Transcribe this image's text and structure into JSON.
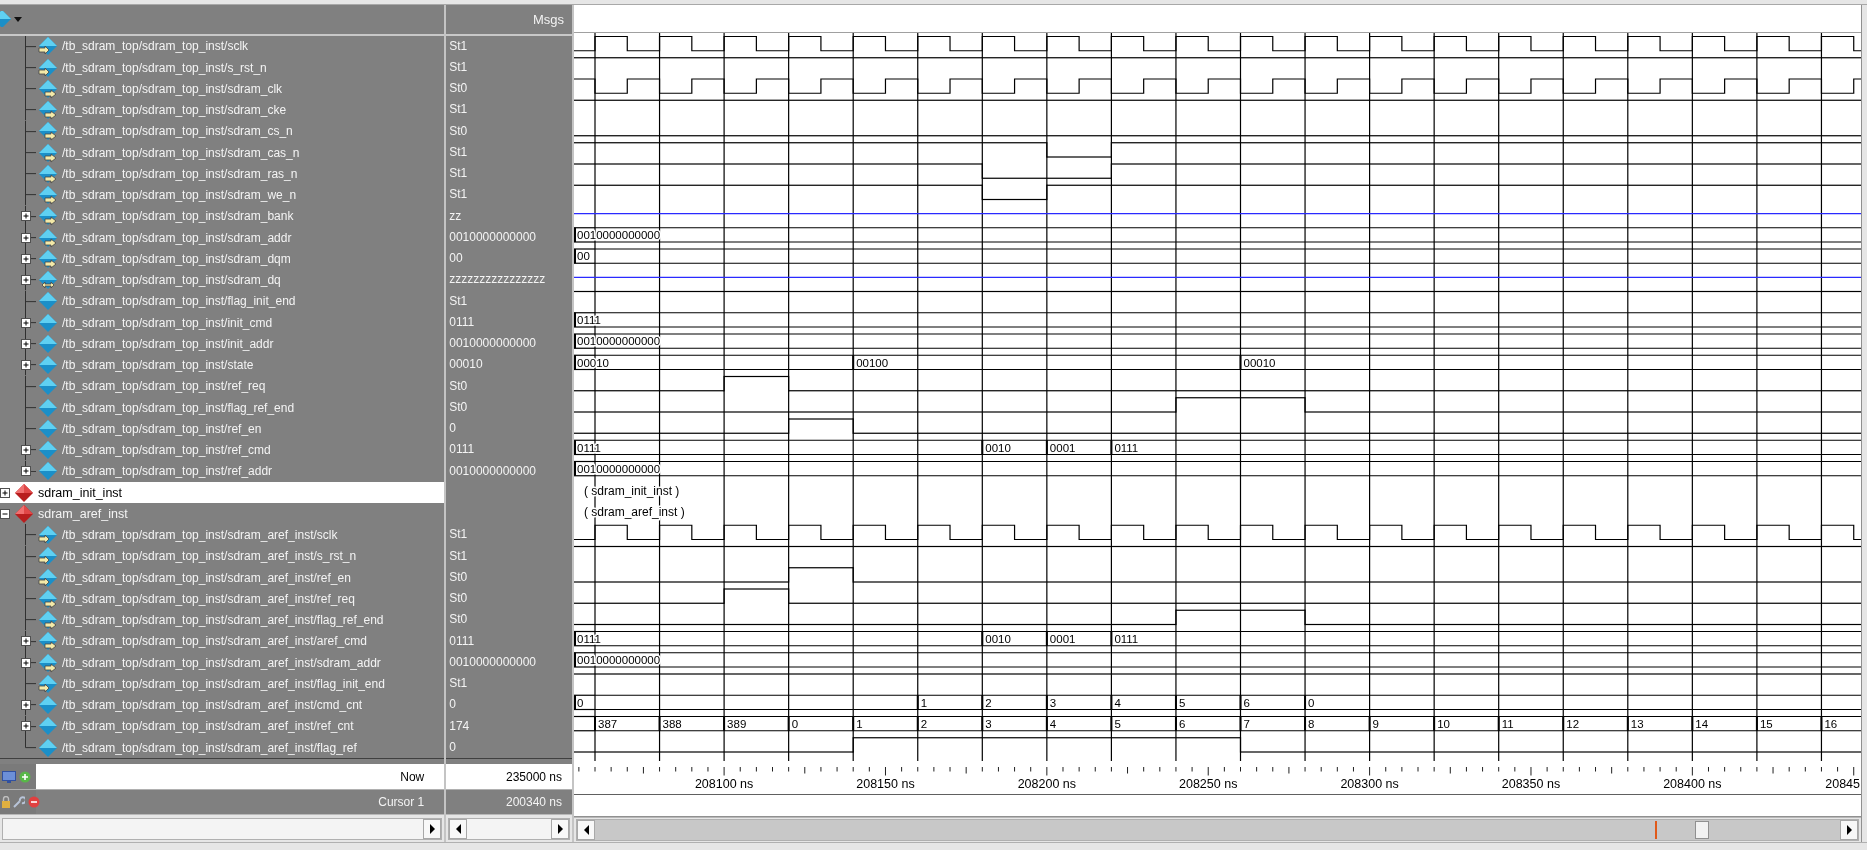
{
  "values_header": "Msgs",
  "time_labels": [
    "208100 ns",
    "208150 ns",
    "208200 ns",
    "208250 ns",
    "208300 ns",
    "208350 ns",
    "208400 ns",
    "20845"
  ],
  "signals": [
    {
      "name": "/tb_sdram_top/sdram_top_inst/sclk",
      "value": "St1",
      "kind": "input",
      "wave": {
        "kind": "clock",
        "inverted": false
      }
    },
    {
      "name": "/tb_sdram_top/sdram_top_inst/s_rst_n",
      "value": "St1",
      "kind": "input",
      "wave": {
        "kind": "bit",
        "high": [
          true,
          true,
          true,
          true,
          true,
          true,
          true,
          true,
          true,
          true,
          true,
          true,
          true,
          true,
          true,
          true,
          true,
          true,
          true,
          true,
          true
        ]
      }
    },
    {
      "name": "/tb_sdram_top/sdram_top_inst/sdram_clk",
      "value": "St0",
      "kind": "output",
      "wave": {
        "kind": "clock",
        "inverted": true
      }
    },
    {
      "name": "/tb_sdram_top/sdram_top_inst/sdram_cke",
      "value": "St1",
      "kind": "output",
      "wave": {
        "kind": "bit",
        "high": [
          true,
          true,
          true,
          true,
          true,
          true,
          true,
          true,
          true,
          true,
          true,
          true,
          true,
          true,
          true,
          true,
          true,
          true,
          true,
          true,
          true
        ]
      }
    },
    {
      "name": "/tb_sdram_top/sdram_top_inst/sdram_cs_n",
      "value": "St0",
      "kind": "output",
      "wave": {
        "kind": "bit",
        "high": [
          false,
          false,
          false,
          false,
          false,
          false,
          false,
          false,
          false,
          false,
          false,
          false,
          false,
          false,
          false,
          false,
          false,
          false,
          false,
          false,
          false
        ]
      }
    },
    {
      "name": "/tb_sdram_top/sdram_top_inst/sdram_cas_n",
      "value": "St1",
      "kind": "output",
      "wave": {
        "kind": "bit",
        "high": [
          true,
          true,
          true,
          true,
          true,
          true,
          true,
          true,
          false,
          true,
          true,
          true,
          true,
          true,
          true,
          true,
          true,
          true,
          true,
          true,
          true
        ]
      }
    },
    {
      "name": "/tb_sdram_top/sdram_top_inst/sdram_ras_n",
      "value": "St1",
      "kind": "output",
      "wave": {
        "kind": "bit",
        "high": [
          true,
          true,
          true,
          true,
          true,
          true,
          true,
          false,
          false,
          true,
          true,
          true,
          true,
          true,
          true,
          true,
          true,
          true,
          true,
          true,
          true
        ]
      }
    },
    {
      "name": "/tb_sdram_top/sdram_top_inst/sdram_we_n",
      "value": "St1",
      "kind": "output",
      "wave": {
        "kind": "bit",
        "high": [
          true,
          true,
          true,
          true,
          true,
          true,
          true,
          false,
          true,
          true,
          true,
          true,
          true,
          true,
          true,
          true,
          true,
          true,
          true,
          true,
          true
        ]
      }
    },
    {
      "name": "/tb_sdram_top/sdram_top_inst/sdram_bank",
      "value": "zz",
      "kind": "output",
      "expanded": false,
      "wave": {
        "kind": "float"
      }
    },
    {
      "name": "/tb_sdram_top/sdram_top_inst/sdram_addr",
      "value": "0010000000000",
      "kind": "output",
      "expanded": false,
      "wave": {
        "kind": "bus",
        "cycles": [
          {
            "new": true,
            "value": "0010000000000"
          },
          {
            "new": false
          },
          {
            "new": false
          },
          {
            "new": false
          },
          {
            "new": false
          },
          {
            "new": false
          },
          {
            "new": false
          },
          {
            "new": false
          },
          {
            "new": false
          },
          {
            "new": false
          },
          {
            "new": false
          },
          {
            "new": false
          },
          {
            "new": false
          },
          {
            "new": false
          },
          {
            "new": false
          },
          {
            "new": false
          },
          {
            "new": false
          },
          {
            "new": false
          },
          {
            "new": false
          },
          {
            "new": false
          },
          {
            "new": false
          }
        ]
      }
    },
    {
      "name": "/tb_sdram_top/sdram_top_inst/sdram_dqm",
      "value": "00",
      "kind": "output",
      "expanded": false,
      "wave": {
        "kind": "bus",
        "cycles": [
          {
            "new": true,
            "value": "00"
          },
          {
            "new": false
          },
          {
            "new": false
          },
          {
            "new": false
          },
          {
            "new": false
          },
          {
            "new": false
          },
          {
            "new": false
          },
          {
            "new": false
          },
          {
            "new": false
          },
          {
            "new": false
          },
          {
            "new": false
          },
          {
            "new": false
          },
          {
            "new": false
          },
          {
            "new": false
          },
          {
            "new": false
          },
          {
            "new": false
          },
          {
            "new": false
          },
          {
            "new": false
          },
          {
            "new": false
          },
          {
            "new": false
          },
          {
            "new": false
          }
        ]
      }
    },
    {
      "name": "/tb_sdram_top/sdram_top_inst/sdram_dq",
      "value": "zzzzzzzzzzzzzzzz",
      "kind": "inout",
      "expanded": false,
      "wave": {
        "kind": "float"
      }
    },
    {
      "name": "/tb_sdram_top/sdram_top_inst/flag_init_end",
      "value": "St1",
      "kind": "internal",
      "wave": {
        "kind": "bit",
        "high": [
          true,
          true,
          true,
          true,
          true,
          true,
          true,
          true,
          true,
          true,
          true,
          true,
          true,
          true,
          true,
          true,
          true,
          true,
          true,
          true,
          true
        ]
      }
    },
    {
      "name": "/tb_sdram_top/sdram_top_inst/init_cmd",
      "value": "0111",
      "kind": "internal",
      "expanded": false,
      "wave": {
        "kind": "bus",
        "cycles": [
          {
            "new": true,
            "value": "0111"
          },
          {
            "new": false
          },
          {
            "new": false
          },
          {
            "new": false
          },
          {
            "new": false
          },
          {
            "new": false
          },
          {
            "new": false
          },
          {
            "new": false
          },
          {
            "new": false
          },
          {
            "new": false
          },
          {
            "new": false
          },
          {
            "new": false
          },
          {
            "new": false
          },
          {
            "new": false
          },
          {
            "new": false
          },
          {
            "new": false
          },
          {
            "new": false
          },
          {
            "new": false
          },
          {
            "new": false
          },
          {
            "new": false
          },
          {
            "new": false
          }
        ]
      }
    },
    {
      "name": "/tb_sdram_top/sdram_top_inst/init_addr",
      "value": "0010000000000",
      "kind": "internal",
      "expanded": false,
      "wave": {
        "kind": "bus",
        "cycles": [
          {
            "new": true,
            "value": "0010000000000"
          },
          {
            "new": false
          },
          {
            "new": false
          },
          {
            "new": false
          },
          {
            "new": false
          },
          {
            "new": false
          },
          {
            "new": false
          },
          {
            "new": false
          },
          {
            "new": false
          },
          {
            "new": false
          },
          {
            "new": false
          },
          {
            "new": false
          },
          {
            "new": false
          },
          {
            "new": false
          },
          {
            "new": false
          },
          {
            "new": false
          },
          {
            "new": false
          },
          {
            "new": false
          },
          {
            "new": false
          },
          {
            "new": false
          },
          {
            "new": false
          }
        ]
      }
    },
    {
      "name": "/tb_sdram_top/sdram_top_inst/state",
      "value": "00010",
      "kind": "internal",
      "expanded": false,
      "wave": {
        "kind": "bus",
        "cycles": [
          {
            "new": true,
            "value": "00010"
          },
          {
            "new": false
          },
          {
            "new": false
          },
          {
            "new": false
          },
          {
            "new": false
          },
          {
            "new": true,
            "value": "00100"
          },
          {
            "new": false
          },
          {
            "new": false
          },
          {
            "new": false
          },
          {
            "new": false
          },
          {
            "new": false
          },
          {
            "new": true,
            "value": "00010"
          },
          {
            "new": false
          },
          {
            "new": false
          },
          {
            "new": false
          },
          {
            "new": false
          },
          {
            "new": false
          },
          {
            "new": false
          },
          {
            "new": false
          },
          {
            "new": false
          },
          {
            "new": false
          }
        ]
      }
    },
    {
      "name": "/tb_sdram_top/sdram_top_inst/ref_req",
      "value": "St0",
      "kind": "internal",
      "wave": {
        "kind": "bit",
        "high": [
          false,
          false,
          false,
          true,
          false,
          false,
          false,
          false,
          false,
          false,
          false,
          false,
          false,
          false,
          false,
          false,
          false,
          false,
          false,
          false,
          false
        ]
      }
    },
    {
      "name": "/tb_sdram_top/sdram_top_inst/flag_ref_end",
      "value": "St0",
      "kind": "internal",
      "wave": {
        "kind": "bit",
        "high": [
          false,
          false,
          false,
          false,
          false,
          false,
          false,
          false,
          false,
          false,
          true,
          true,
          false,
          false,
          false,
          false,
          false,
          false,
          false,
          false,
          false
        ]
      }
    },
    {
      "name": "/tb_sdram_top/sdram_top_inst/ref_en",
      "value": "0",
      "kind": "internal",
      "wave": {
        "kind": "bit",
        "high": [
          false,
          false,
          false,
          false,
          true,
          false,
          false,
          false,
          false,
          false,
          false,
          false,
          false,
          false,
          false,
          false,
          false,
          false,
          false,
          false,
          false
        ]
      }
    },
    {
      "name": "/tb_sdram_top/sdram_top_inst/ref_cmd",
      "value": "0111",
      "kind": "internal",
      "expanded": false,
      "wave": {
        "kind": "bus",
        "cycles": [
          {
            "new": true,
            "value": "0111"
          },
          {
            "new": false
          },
          {
            "new": false
          },
          {
            "new": false
          },
          {
            "new": false
          },
          {
            "new": false
          },
          {
            "new": false
          },
          {
            "new": true,
            "value": "0010"
          },
          {
            "new": true,
            "value": "0001"
          },
          {
            "new": true,
            "value": "0111"
          },
          {
            "new": false
          },
          {
            "new": false
          },
          {
            "new": false
          },
          {
            "new": false
          },
          {
            "new": false
          },
          {
            "new": false
          },
          {
            "new": false
          },
          {
            "new": false
          },
          {
            "new": false
          },
          {
            "new": false
          },
          {
            "new": false
          }
        ]
      }
    },
    {
      "name": "/tb_sdram_top/sdram_top_inst/ref_addr",
      "value": "0010000000000",
      "kind": "internal",
      "expanded": false,
      "wave": {
        "kind": "bus",
        "cycles": [
          {
            "new": true,
            "value": "0010000000000"
          },
          {
            "new": false
          },
          {
            "new": false
          },
          {
            "new": false
          },
          {
            "new": false
          },
          {
            "new": false
          },
          {
            "new": false
          },
          {
            "new": false
          },
          {
            "new": false
          },
          {
            "new": false
          },
          {
            "new": false
          },
          {
            "new": false
          },
          {
            "new": false
          },
          {
            "new": false
          },
          {
            "new": false
          },
          {
            "new": false
          },
          {
            "new": false
          },
          {
            "new": false
          },
          {
            "new": false
          },
          {
            "new": false
          },
          {
            "new": false
          }
        ]
      }
    }
  ],
  "instances": [
    {
      "name": "sdram_init_inst",
      "expanded": false,
      "selected": true,
      "wave_label": "( sdram_init_inst )"
    },
    {
      "name": "sdram_aref_inst",
      "expanded": true,
      "selected": false,
      "wave_label": "( sdram_aref_inst )",
      "children": [
        {
          "name": "/tb_sdram_top/sdram_top_inst/sdram_aref_inst/sclk",
          "value": "St1",
          "kind": "input",
          "wave": {
            "kind": "clock",
            "inverted": false
          }
        },
        {
          "name": "/tb_sdram_top/sdram_top_inst/sdram_aref_inst/s_rst_n",
          "value": "St1",
          "kind": "input",
          "wave": {
            "kind": "bit",
            "high": [
              true,
              true,
              true,
              true,
              true,
              true,
              true,
              true,
              true,
              true,
              true,
              true,
              true,
              true,
              true,
              true,
              true,
              true,
              true,
              true,
              true
            ]
          }
        },
        {
          "name": "/tb_sdram_top/sdram_top_inst/sdram_aref_inst/ref_en",
          "value": "St0",
          "kind": "input",
          "wave": {
            "kind": "bit",
            "high": [
              false,
              false,
              false,
              false,
              true,
              false,
              false,
              false,
              false,
              false,
              false,
              false,
              false,
              false,
              false,
              false,
              false,
              false,
              false,
              false,
              false
            ]
          }
        },
        {
          "name": "/tb_sdram_top/sdram_top_inst/sdram_aref_inst/ref_req",
          "value": "St0",
          "kind": "output",
          "wave": {
            "kind": "bit",
            "high": [
              false,
              false,
              false,
              true,
              false,
              false,
              false,
              false,
              false,
              false,
              false,
              false,
              false,
              false,
              false,
              false,
              false,
              false,
              false,
              false,
              false
            ]
          }
        },
        {
          "name": "/tb_sdram_top/sdram_top_inst/sdram_aref_inst/flag_ref_end",
          "value": "St0",
          "kind": "output",
          "wave": {
            "kind": "bit",
            "high": [
              false,
              false,
              false,
              false,
              false,
              false,
              false,
              false,
              false,
              false,
              true,
              true,
              false,
              false,
              false,
              false,
              false,
              false,
              false,
              false,
              false
            ]
          }
        },
        {
          "name": "/tb_sdram_top/sdram_top_inst/sdram_aref_inst/aref_cmd",
          "value": "0111",
          "kind": "output",
          "expanded": false,
          "wave": {
            "kind": "bus",
            "cycles": [
              {
                "new": true,
                "value": "0111"
              },
              {
                "new": false
              },
              {
                "new": false
              },
              {
                "new": false
              },
              {
                "new": false
              },
              {
                "new": false
              },
              {
                "new": false
              },
              {
                "new": true,
                "value": "0010"
              },
              {
                "new": true,
                "value": "0001"
              },
              {
                "new": true,
                "value": "0111"
              },
              {
                "new": false
              },
              {
                "new": false
              },
              {
                "new": false
              },
              {
                "new": false
              },
              {
                "new": false
              },
              {
                "new": false
              },
              {
                "new": false
              },
              {
                "new": false
              },
              {
                "new": false
              },
              {
                "new": false
              },
              {
                "new": false
              }
            ]
          }
        },
        {
          "name": "/tb_sdram_top/sdram_top_inst/sdram_aref_inst/sdram_addr",
          "value": "0010000000000",
          "kind": "output",
          "expanded": false,
          "wave": {
            "kind": "bus",
            "cycles": [
              {
                "new": true,
                "value": "0010000000000"
              },
              {
                "new": false
              },
              {
                "new": false
              },
              {
                "new": false
              },
              {
                "new": false
              },
              {
                "new": false
              },
              {
                "new": false
              },
              {
                "new": false
              },
              {
                "new": false
              },
              {
                "new": false
              },
              {
                "new": false
              },
              {
                "new": false
              },
              {
                "new": false
              },
              {
                "new": false
              },
              {
                "new": false
              },
              {
                "new": false
              },
              {
                "new": false
              },
              {
                "new": false
              },
              {
                "new": false
              },
              {
                "new": false
              },
              {
                "new": false
              }
            ]
          }
        },
        {
          "name": "/tb_sdram_top/sdram_top_inst/sdram_aref_inst/flag_init_end",
          "value": "St1",
          "kind": "input",
          "wave": {
            "kind": "bit",
            "high": [
              true,
              true,
              true,
              true,
              true,
              true,
              true,
              true,
              true,
              true,
              true,
              true,
              true,
              true,
              true,
              true,
              true,
              true,
              true,
              true,
              true
            ]
          }
        },
        {
          "name": "/tb_sdram_top/sdram_top_inst/sdram_aref_inst/cmd_cnt",
          "value": "0",
          "kind": "internal",
          "expanded": false,
          "wave": {
            "kind": "bus",
            "cycles": [
              {
                "new": true,
                "value": "0"
              },
              {
                "new": false
              },
              {
                "new": false
              },
              {
                "new": false
              },
              {
                "new": false
              },
              {
                "new": false
              },
              {
                "new": true,
                "value": "1"
              },
              {
                "new": true,
                "value": "2"
              },
              {
                "new": true,
                "value": "3"
              },
              {
                "new": true,
                "value": "4"
              },
              {
                "new": true,
                "value": "5"
              },
              {
                "new": true,
                "value": "6"
              },
              {
                "new": true,
                "value": "0"
              },
              {
                "new": false
              },
              {
                "new": false
              },
              {
                "new": false
              },
              {
                "new": false
              },
              {
                "new": false
              },
              {
                "new": false
              },
              {
                "new": false
              },
              {
                "new": false
              }
            ]
          }
        },
        {
          "name": "/tb_sdram_top/sdram_top_inst/sdram_aref_inst/ref_cnt",
          "value": "174",
          "kind": "internal",
          "expanded": false,
          "wave": {
            "kind": "bus",
            "cycles": [
              {
                "new": false
              },
              {
                "new": true,
                "value": "387"
              },
              {
                "new": true,
                "value": "388"
              },
              {
                "new": true,
                "value": "389"
              },
              {
                "new": true,
                "value": "0"
              },
              {
                "new": true,
                "value": "1"
              },
              {
                "new": true,
                "value": "2"
              },
              {
                "new": true,
                "value": "3"
              },
              {
                "new": true,
                "value": "4"
              },
              {
                "new": true,
                "value": "5"
              },
              {
                "new": true,
                "value": "6"
              },
              {
                "new": true,
                "value": "7"
              },
              {
                "new": true,
                "value": "8"
              },
              {
                "new": true,
                "value": "9"
              },
              {
                "new": true,
                "value": "10"
              },
              {
                "new": true,
                "value": "11"
              },
              {
                "new": true,
                "value": "12"
              },
              {
                "new": true,
                "value": "13"
              },
              {
                "new": true,
                "value": "14"
              },
              {
                "new": true,
                "value": "15"
              },
              {
                "new": true,
                "value": "16"
              }
            ]
          }
        },
        {
          "name": "/tb_sdram_top/sdram_top_inst/sdram_aref_inst/flag_ref",
          "value": "0",
          "kind": "internal",
          "wave": {
            "kind": "bit",
            "high": [
              false,
              false,
              false,
              false,
              false,
              true,
              true,
              true,
              true,
              true,
              true,
              false,
              false,
              false,
              false,
              false,
              false,
              false,
              false,
              false,
              false
            ]
          }
        }
      ]
    }
  ],
  "now": {
    "label": "Now",
    "value": "235000 ns"
  },
  "cursors": [
    {
      "label": "Cursor 1",
      "value": "200340 ns"
    }
  ]
}
